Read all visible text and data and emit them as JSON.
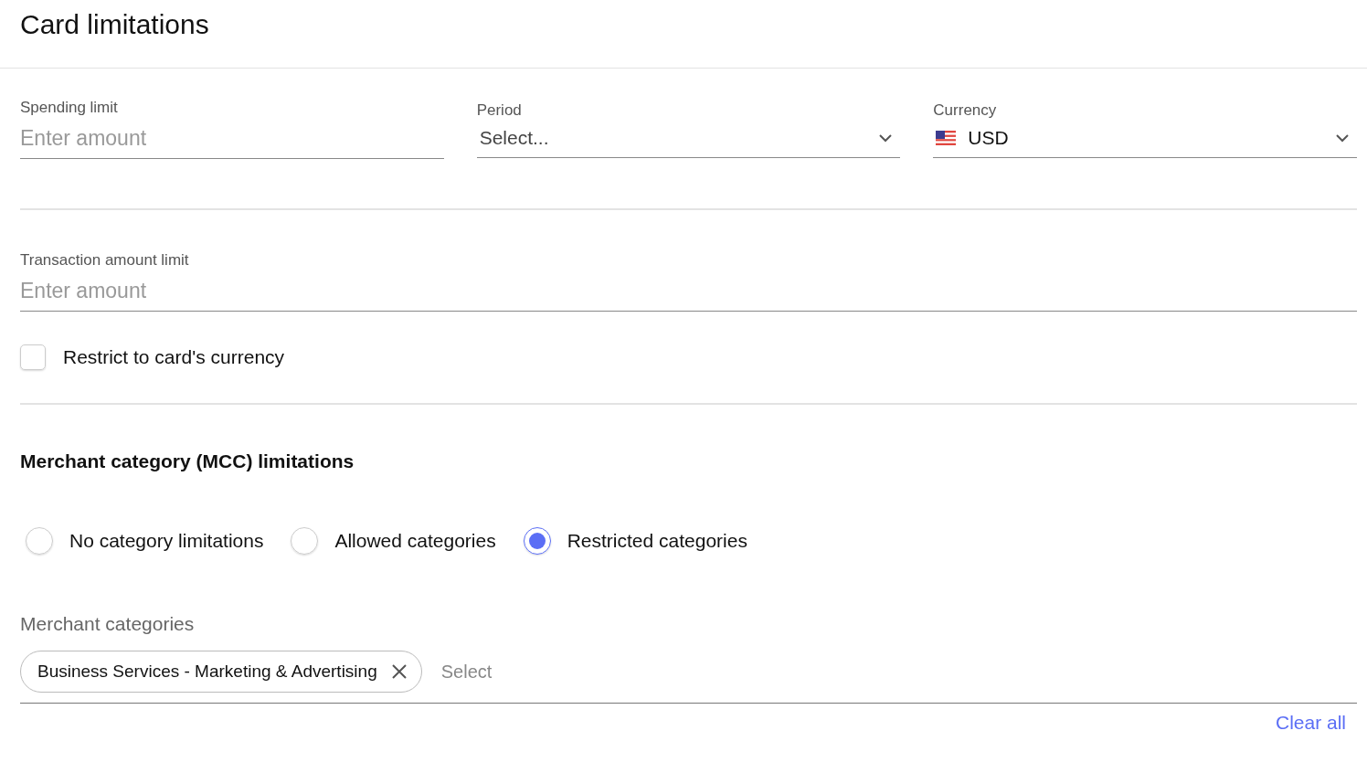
{
  "title": "Card limitations",
  "limit_fields": [
    {
      "kind": "input",
      "label": "Spending limit",
      "placeholder": "Enter amount"
    },
    {
      "kind": "select",
      "label": "Period",
      "placeholder": "Select..."
    },
    {
      "kind": "currency",
      "label": "Currency",
      "value": "USD"
    }
  ],
  "transaction_field": {
    "label": "Transaction amount limit",
    "placeholder": "Enter amount"
  },
  "restrict_currency": {
    "label": "Restrict to card's currency",
    "checked": false
  },
  "mcc": {
    "heading": "Merchant category (MCC) limitations",
    "options": [
      {
        "label": "No category limitations",
        "selected": false
      },
      {
        "label": "Allowed categories",
        "selected": false
      },
      {
        "label": "Restricted categories",
        "selected": true
      }
    ],
    "categories_label": "Merchant categories",
    "chips": [
      {
        "label": "Business Services - Marketing & Advertising"
      }
    ],
    "select_placeholder": "Select",
    "clear_all": "Clear all"
  }
}
